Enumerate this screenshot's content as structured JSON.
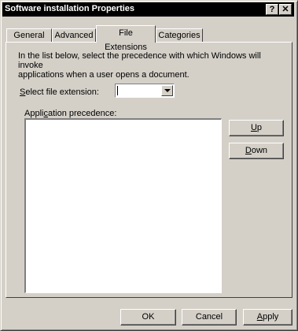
{
  "window": {
    "title": "Software installation Properties",
    "help_label": "?",
    "close_label": "✕"
  },
  "tabs": [
    {
      "label": "General",
      "active": false
    },
    {
      "label": "Advanced",
      "active": false
    },
    {
      "label": "File Extensions",
      "active": true
    },
    {
      "label": "Categories",
      "active": false
    }
  ],
  "content": {
    "intro_line1": "In the list below, select the precedence with which Windows will invoke",
    "intro_line2": "applications when a user opens a document.",
    "ext_label_mnemonic": "S",
    "ext_label_rest": "elect file extension:",
    "ext_value": "",
    "prec_label_before": "Appli",
    "prec_label_mnemonic": "c",
    "prec_label_after": "ation precedence:",
    "up_mnemonic": "U",
    "up_rest": "p",
    "down_mnemonic": "D",
    "down_rest": "own"
  },
  "footer": {
    "ok_label": "OK",
    "cancel_label": "Cancel",
    "apply_mnemonic": "A",
    "apply_rest": "pply"
  }
}
